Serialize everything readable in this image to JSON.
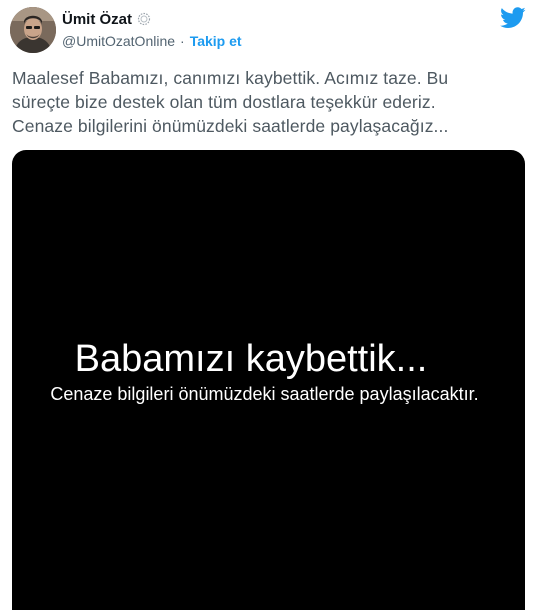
{
  "author": {
    "name": "Ümit Özat",
    "handle": "@UmitOzatOnline",
    "follow_label": "Takip et",
    "separator": "·"
  },
  "icons": {
    "brand": "twitter-bird-icon",
    "brand_color": "#1d9bf0",
    "verified": "verified-badge-icon"
  },
  "tweet": {
    "lines": [
      "Maalesef Babamızı, canımızı kaybettik. Acımız taze. Bu",
      "süreçte bize destek olan tüm dostlara teşekkür ederiz.",
      "Cenaze bilgilerini önümüzdeki saatlerde paylaşacağız..."
    ]
  },
  "media": {
    "headline": "Babamızı kaybettik...",
    "subline": "Cenaze bilgileri önümüzdeki saatlerde paylaşılacaktır."
  }
}
